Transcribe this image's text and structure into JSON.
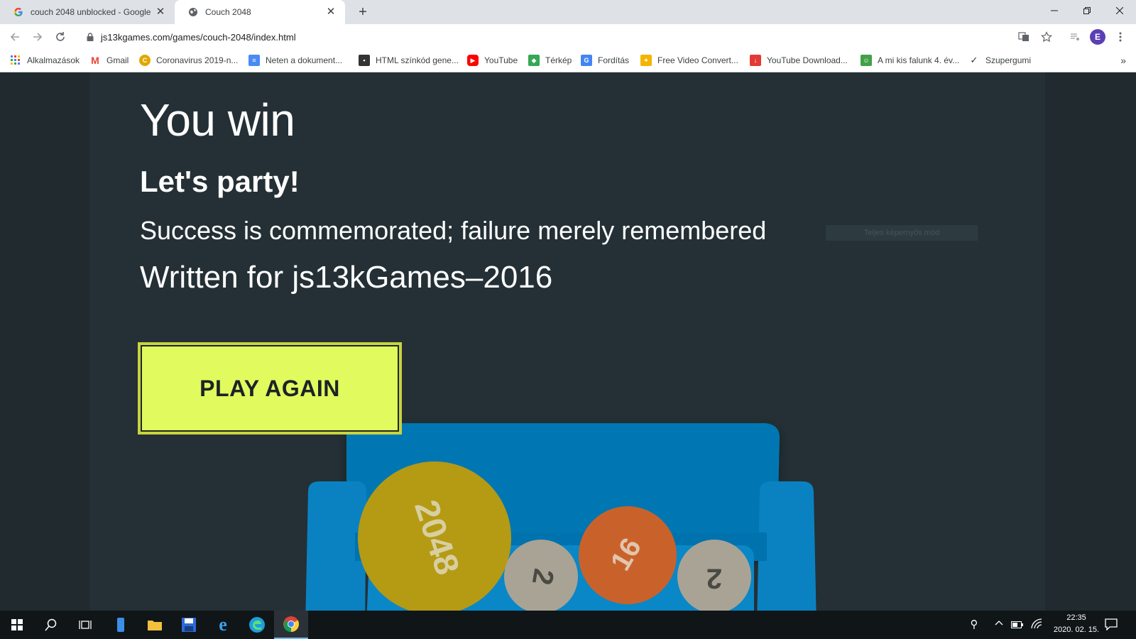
{
  "browser": {
    "tabs": [
      {
        "title": "couch 2048 unblocked - Google",
        "favicon": "google-g-icon",
        "active": false
      },
      {
        "title": "Couch 2048",
        "favicon": "globe-icon",
        "active": true
      }
    ],
    "url": "js13kgames.com/games/couch-2048/index.html",
    "profile_initial": "E",
    "bookmarks": [
      {
        "label": "Alkalmazások",
        "icon": "apps-grid-icon"
      },
      {
        "label": "Gmail",
        "icon": "gmail-icon"
      },
      {
        "label": "Coronavirus 2019-n...",
        "icon": "coronavirus-icon"
      },
      {
        "label": "Neten a dokument...",
        "icon": "docs-icon"
      },
      {
        "label": "HTML színkód gene...",
        "icon": "html-icon"
      },
      {
        "label": "YouTube",
        "icon": "youtube-icon"
      },
      {
        "label": "Térkép",
        "icon": "maps-icon"
      },
      {
        "label": "Fordítás",
        "icon": "translate-icon"
      },
      {
        "label": "Free Video Convert...",
        "icon": "video-convert-icon"
      },
      {
        "label": "YouTube Download...",
        "icon": "download-icon"
      },
      {
        "label": "A mi kis falunk 4. év...",
        "icon": "village-icon"
      },
      {
        "label": "Szupergumi",
        "icon": "check-icon"
      }
    ]
  },
  "game": {
    "title": "You win",
    "subtitle": "Let's party!",
    "tagline": "Success is commemorated; failure merely remembered",
    "credit": "Written for js13kGames–2016",
    "play_again": "PLAY AGAIN",
    "fullscreen_tip": "Teljes képernyős mód",
    "balls": [
      "2048",
      "2",
      "16",
      "2"
    ]
  },
  "taskbar": {
    "time": "22:35",
    "date": "2020. 02. 15."
  }
}
